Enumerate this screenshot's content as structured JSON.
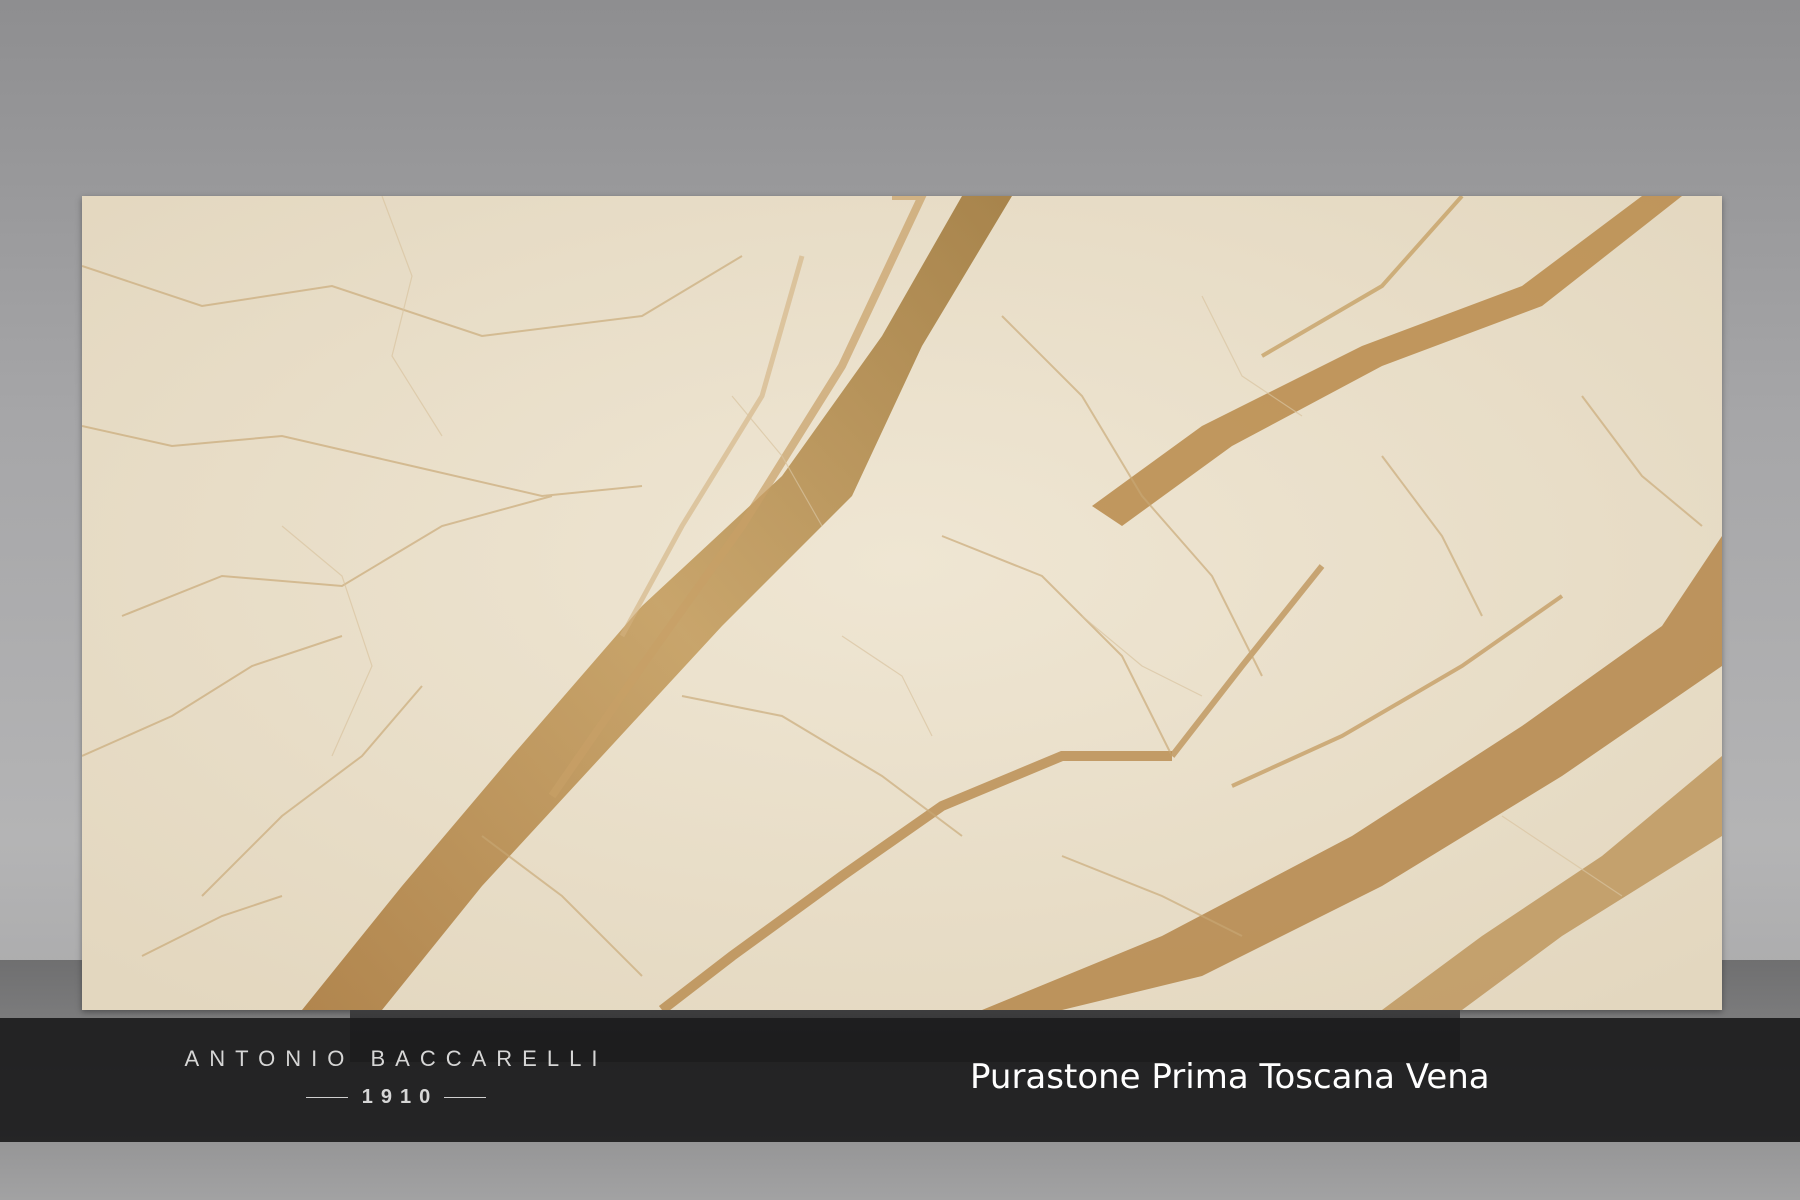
{
  "brand": {
    "name": "ANTONIO BACCARELLI",
    "year": "1910"
  },
  "product": {
    "title": "Purastone Prima Toscana Vena"
  },
  "colors": {
    "slab_base": "#e9dfcb",
    "vein_gold": "#b98a45",
    "vein_dark": "#8e6a32",
    "banner_bg": "#1c1c1d",
    "backdrop": "#a6a6a8"
  }
}
